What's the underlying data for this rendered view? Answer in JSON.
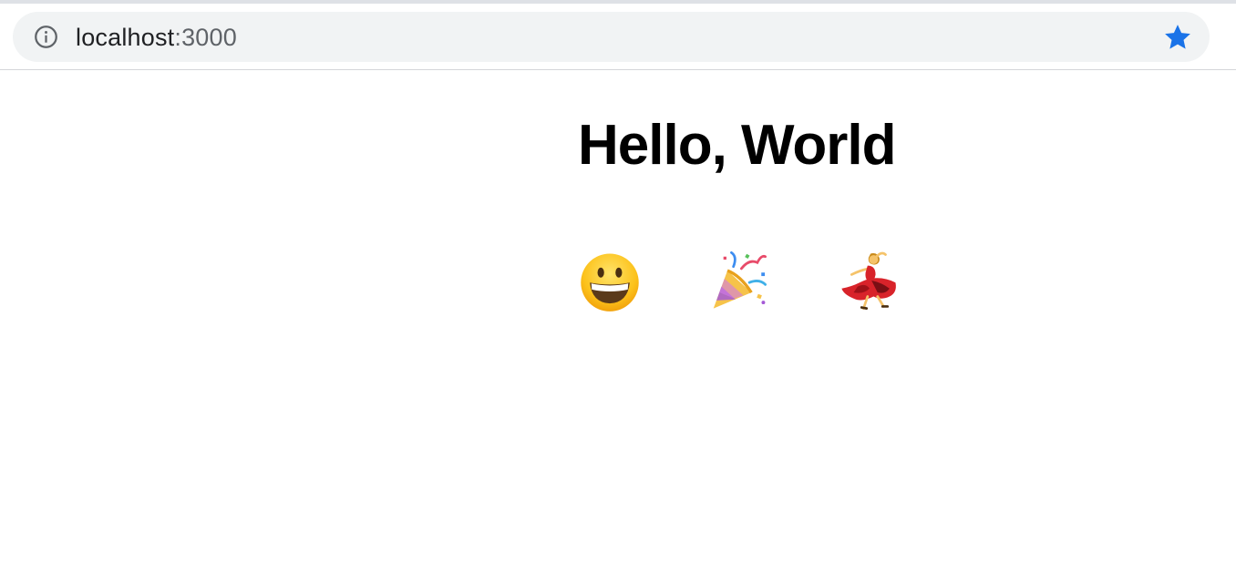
{
  "browser": {
    "url_host": "localhost",
    "url_port": ":3000",
    "icons": {
      "info": "info-icon",
      "bookmark": "star-icon"
    },
    "colors": {
      "omnibox_bg": "#f1f3f4",
      "star": "#1a73e8"
    }
  },
  "page": {
    "heading": "Hello, World",
    "emojis": [
      {
        "name": "grinning-face-emoji",
        "char": "😀"
      },
      {
        "name": "party-popper-emoji",
        "char": "🎉"
      },
      {
        "name": "woman-dancing-emoji",
        "char": "💃"
      }
    ]
  }
}
